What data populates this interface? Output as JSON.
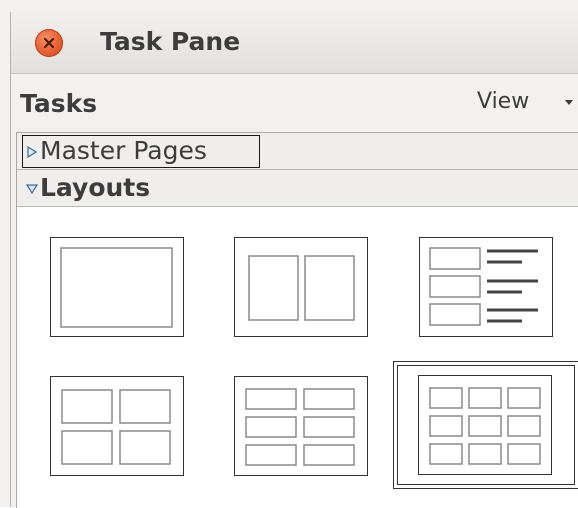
{
  "window": {
    "title": "Task Pane",
    "close_icon": "close-icon"
  },
  "toolbar": {
    "tasks_label": "Tasks",
    "view_label": "View"
  },
  "sections": {
    "master_pages": {
      "label": "Master Pages",
      "expanded": false,
      "focused": true
    },
    "layouts": {
      "label": "Layouts",
      "expanded": true
    }
  },
  "layouts": {
    "items": [
      {
        "name": "blank-slide",
        "selected": false
      },
      {
        "name": "two-content",
        "selected": false
      },
      {
        "name": "title-content-list",
        "selected": false
      },
      {
        "name": "four-content",
        "selected": false
      },
      {
        "name": "six-content",
        "selected": false
      },
      {
        "name": "nine-content",
        "selected": true
      }
    ]
  },
  "colors": {
    "close_button": "#ec6637",
    "panel_background": "#ffffff",
    "window_background": "#f2f1f0"
  }
}
